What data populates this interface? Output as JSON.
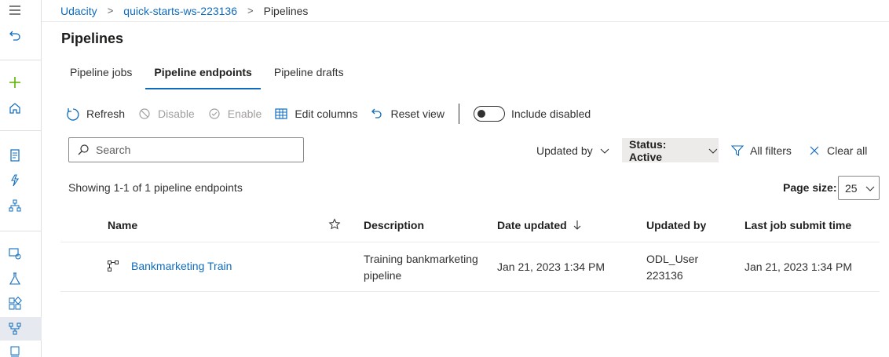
{
  "breadcrumb": {
    "items": [
      "Udacity",
      "quick-starts-ws-223136"
    ],
    "separator": ">",
    "current": "Pipelines"
  },
  "page": {
    "title": "Pipelines"
  },
  "tabs": [
    {
      "label": "Pipeline jobs",
      "active": false
    },
    {
      "label": "Pipeline endpoints",
      "active": true
    },
    {
      "label": "Pipeline drafts",
      "active": false
    }
  ],
  "toolbar": {
    "refresh": "Refresh",
    "disable": "Disable",
    "enable": "Enable",
    "edit_columns": "Edit columns",
    "reset_view": "Reset view",
    "include_disabled": "Include disabled"
  },
  "search": {
    "placeholder": "Search"
  },
  "filters": {
    "updated_by": "Updated by",
    "status": "Status: Active",
    "all_filters": "All filters",
    "clear_all": "Clear all"
  },
  "summary": {
    "showing": "Showing 1-1 of 1 pipeline endpoints"
  },
  "pagination": {
    "label": "Page size:",
    "value": "25"
  },
  "table": {
    "columns": {
      "name": "Name",
      "description": "Description",
      "date_updated": "Date updated",
      "updated_by": "Updated by",
      "last_job": "Last job submit time"
    },
    "rows": [
      {
        "name": "Bankmarketing Train",
        "description_line1": "Training bankmarketing",
        "description_line2": "pipeline",
        "date_updated": "Jan 21, 2023 1:34 PM",
        "updated_by_line1": "ODL_User",
        "updated_by_line2": "223136",
        "last_job": "Jan 21, 2023 1:34 PM"
      }
    ]
  },
  "colors": {
    "accent": "#0f6cbd",
    "text": "#323130",
    "border": "#edebe9"
  }
}
